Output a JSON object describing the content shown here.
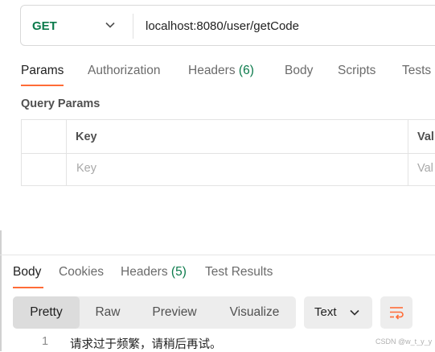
{
  "request": {
    "method": "GET",
    "url": "localhost:8080/user/getCode"
  },
  "request_tabs": [
    {
      "label": "Params"
    },
    {
      "label": "Authorization"
    },
    {
      "label": "Headers",
      "count": "(6)"
    },
    {
      "label": "Body"
    },
    {
      "label": "Scripts"
    },
    {
      "label": "Tests"
    }
  ],
  "params": {
    "section_title": "Query Params",
    "column_key": "Key",
    "column_value": "Val",
    "key_placeholder": "Key",
    "value_placeholder": "Val"
  },
  "response_tabs": [
    {
      "label": "Body"
    },
    {
      "label": "Cookies"
    },
    {
      "label": "Headers",
      "count": "(5)"
    },
    {
      "label": "Test Results"
    }
  ],
  "view_modes": [
    "Pretty",
    "Raw",
    "Preview",
    "Visualize"
  ],
  "format": "Text",
  "response_lines": [
    {
      "number": "1",
      "text": "请求过于频繁，请稍后再试。"
    }
  ],
  "watermark": "CSDN @w_t_y_y",
  "colors": {
    "accent": "#ff6c37",
    "method_get": "#0b7a4b",
    "count": "#0b7a4b"
  }
}
